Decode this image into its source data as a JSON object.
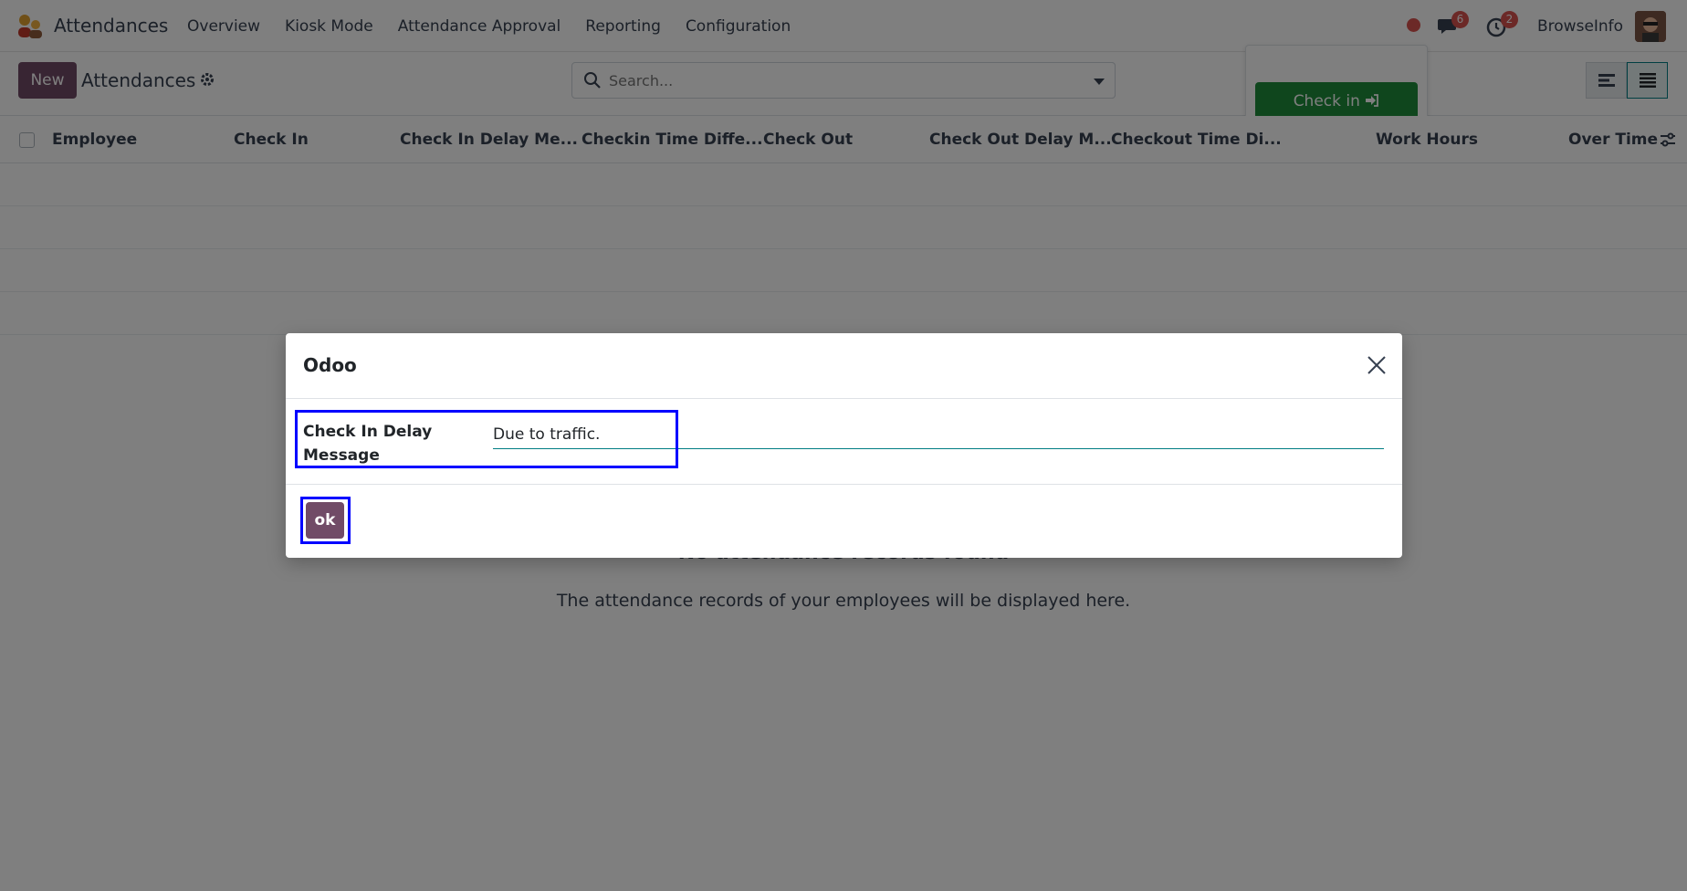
{
  "navbar": {
    "app_name": "Attendances",
    "menu": [
      "Overview",
      "Kiosk Mode",
      "Attendance Approval",
      "Reporting",
      "Configuration"
    ],
    "chat_count": "6",
    "activity_count": "2",
    "user_name": "BrowseInfo"
  },
  "control": {
    "new_label": "New",
    "breadcrumb": "Attendances",
    "search_placeholder": "Search...",
    "checkin_label": "Check in"
  },
  "list": {
    "columns": [
      "Employee",
      "Check In",
      "Check In Delay Me...",
      "Checkin Time Diffe...",
      "Check Out",
      "Check Out Delay M...",
      "Checkout Time Di...",
      "Work Hours",
      "Over Time"
    ]
  },
  "empty_state": {
    "title": "No attendance records found",
    "text": "The attendance records of your employees will be displayed here."
  },
  "dialog": {
    "title": "Odoo",
    "field_label": "Check In Delay Message",
    "field_value": "Due to traffic.",
    "ok_label": "ok"
  },
  "colors": {
    "primary": "#714b67",
    "success": "#1e8c3a",
    "badge": "#d9534f",
    "highlight": "#0000ff"
  }
}
